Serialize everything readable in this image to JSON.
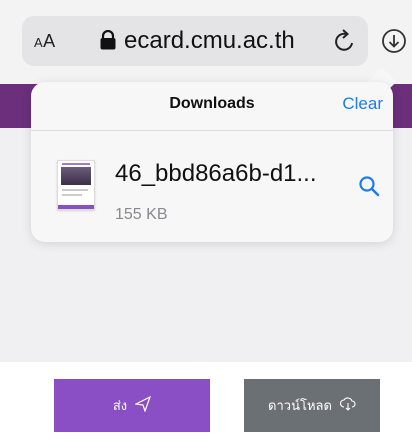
{
  "browser": {
    "text_size_label": "AA",
    "domain": "ecard.cmu.ac.th",
    "icons": [
      "lock-icon",
      "reload-icon",
      "download-icon"
    ]
  },
  "downloads": {
    "title": "Downloads",
    "clear_label": "Clear",
    "items": [
      {
        "name": "46_bbd86a6b-d1...",
        "size": "155 KB",
        "action_icon": "magnifier-icon"
      }
    ]
  },
  "page": {
    "send_label": "ส่ง",
    "send_icon": "send-icon",
    "download_label": "ดาวน์โหลด",
    "download_icon": "cloud-download-icon",
    "colors": {
      "header": "#6b2f7c",
      "send_button": "#8a4fc4",
      "download_button": "#6b7075",
      "link": "#1a7cf0"
    }
  }
}
